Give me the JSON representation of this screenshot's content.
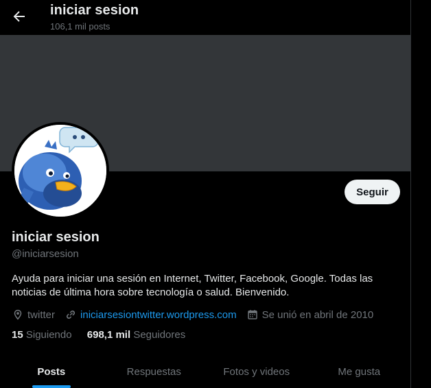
{
  "header": {
    "title": "iniciar sesion",
    "post_count": "106,1 mil posts"
  },
  "profile": {
    "follow_label": "Seguir",
    "name": "iniciar sesion",
    "handle": "@iniciarsesion",
    "bio": "Ayuda para iniciar una sesión en Internet, Twitter, Facebook, Google. Todas las noticias de última hora sobre tecnología o salud. Bienvenido.",
    "location": "twitter",
    "website": "iniciarsesiontwitter.wordpress.com",
    "joined": "Se unió en abril de 2010",
    "following_count": "15",
    "following_label": "Siguiendo",
    "followers_count": "698,1 mil",
    "followers_label": "Seguidores"
  },
  "tabs": [
    {
      "label": "Posts",
      "active": true
    },
    {
      "label": "Respuestas",
      "active": false
    },
    {
      "label": "Fotos y videos",
      "active": false
    },
    {
      "label": "Me gusta",
      "active": false
    }
  ],
  "colors": {
    "background": "#000000",
    "banner": "#333639",
    "accent": "#1d9bf0",
    "muted": "#71767b",
    "text": "#e7e9ea"
  },
  "icons": {
    "back": "arrow-left-icon",
    "location": "location-pin-icon",
    "link": "link-icon",
    "calendar": "calendar-icon",
    "avatar": "blue-bird-avatar"
  }
}
